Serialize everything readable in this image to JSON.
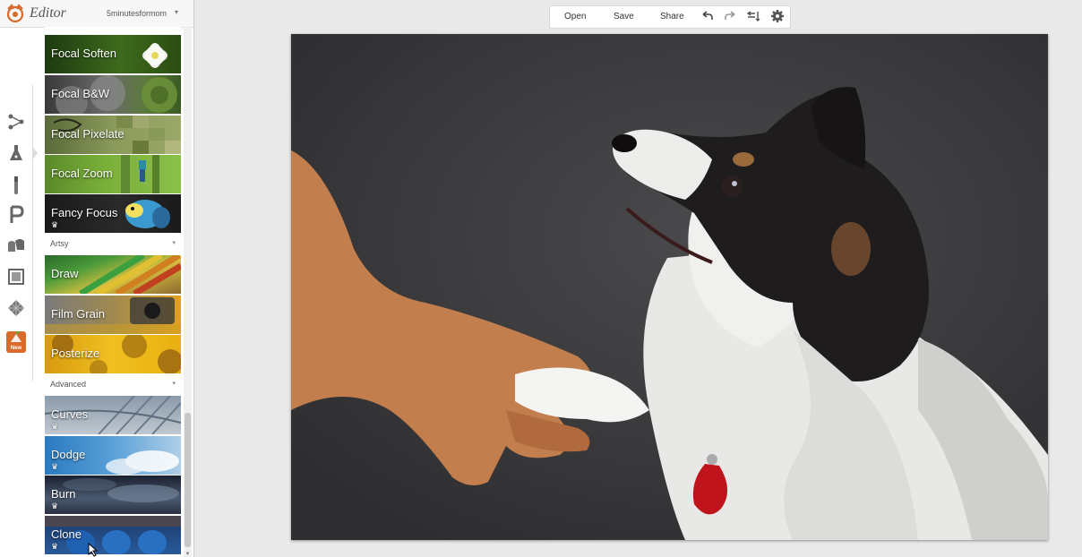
{
  "header": {
    "app_title": "Editor",
    "account_name": "5minutesformom",
    "account_arrow": "▾"
  },
  "rail": {
    "icons": [
      "basic-edits-icon",
      "effects-icon",
      "touch-up-icon",
      "text-icon",
      "overlays-icon",
      "frames-icon",
      "textures-icon",
      "seasonal-new-icon"
    ],
    "new_badge": "New"
  },
  "effects": {
    "focal": [
      {
        "label": "Focal Soften",
        "premium": false
      },
      {
        "label": "Focal B&W",
        "premium": false
      },
      {
        "label": "Focal Pixelate",
        "premium": false
      },
      {
        "label": "Focal Zoom",
        "premium": false
      },
      {
        "label": "Fancy Focus",
        "premium": true
      }
    ],
    "artsy_title": "Artsy",
    "artsy": [
      {
        "label": "Draw",
        "premium": false
      },
      {
        "label": "Film Grain",
        "premium": false
      },
      {
        "label": "Posterize",
        "premium": false
      }
    ],
    "advanced_title": "Advanced",
    "advanced": [
      {
        "label": "Curves",
        "premium": true
      },
      {
        "label": "Dodge",
        "premium": true
      },
      {
        "label": "Burn",
        "premium": true
      },
      {
        "label": "Clone",
        "premium": true
      }
    ],
    "section_arrow": "▾",
    "crown": "♛"
  },
  "toolbar": {
    "open_label": "Open",
    "save_label": "Save",
    "share_label": "Share",
    "icons": [
      "undo-icon",
      "redo-icon",
      "compare-icon",
      "settings-icon"
    ]
  },
  "colors": {
    "accent": "#d86a2c",
    "photo_background": "#3a3a3c",
    "dog_collar_tag": "#c0141c"
  }
}
